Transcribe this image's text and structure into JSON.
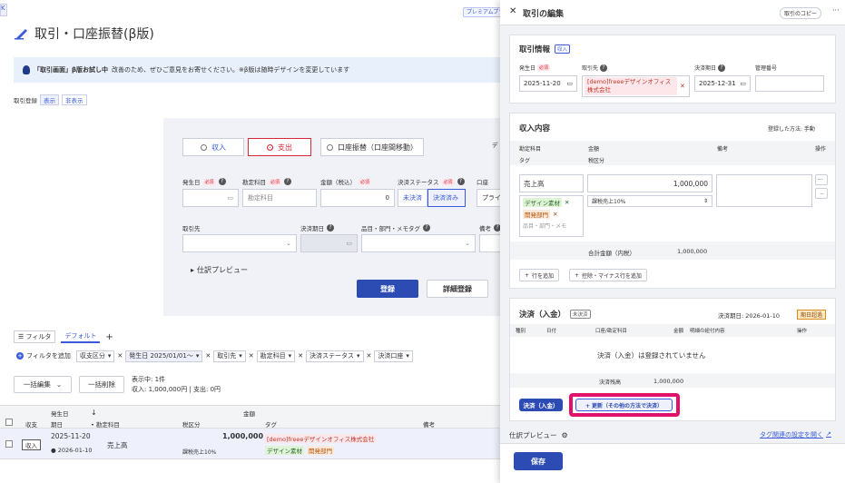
{
  "bg": {
    "edge_btn": "K",
    "premium": "プレミアムプラン",
    "title": "取引・口座振替(β版)",
    "banner": {
      "bold": "「取引画面」β版お試し中",
      "text": "改善のため、ぜひご意見をお寄せください。※β版は随時デザインを変更しています"
    },
    "reg": {
      "label": "取引登録",
      "show": "表示",
      "hide": "非表示"
    },
    "radios": {
      "income": "収入",
      "expense": "支出",
      "transfer": "口座振替（口座間移動）"
    },
    "form": {
      "cut_label": "デ",
      "date": "発生日",
      "account": "勘定科目",
      "account_ph": "勘定科目",
      "amount": "金額（税込）",
      "amount_val": "0",
      "status": "決済ステータス",
      "unpaid": "未決済",
      "paid": "決済済み",
      "acct2": "口座",
      "acct2_val": "プライ",
      "partner": "取引先",
      "due": "決済期日",
      "item": "品目・部門・メモタグ",
      "memo": "備考",
      "preview": "仕訳プレビュー",
      "register": "登録",
      "detail": "詳細登録",
      "required": "必須"
    },
    "filter": {
      "btn": "フィルタ",
      "default": "デフォルト",
      "add": "+",
      "add_filter": "フィルタを追加",
      "chips": [
        "収支区分",
        "発生日 2025/01/01〜",
        "取引先",
        "勘定科目",
        "決済ステータス",
        "決済口座"
      ]
    },
    "bulk": {
      "edit": "一括編集",
      "delete": "一括削除",
      "count": "表示中: 1件",
      "sum": "収入: 1,000,000円 | 支出: 0円"
    },
    "table": {
      "headers": {
        "income_exp": "収支",
        "date_top": "発生日",
        "date": "期日",
        "account": "勘定科目",
        "tax": "税区分",
        "amount": "金額",
        "tag": "タグ",
        "memo": "備考"
      },
      "row": {
        "type": "収入",
        "date": "2025-11-20",
        "due": "2026-01-10",
        "account": "売上高",
        "amount": "1,000,000",
        "tax": "課税売上10%",
        "partner": "[demo]freeeデザインオフィス株式会社",
        "tag1": "デザイン素材",
        "tag2": "開発部門"
      }
    }
  },
  "drawer": {
    "title": "取引の編集",
    "copy": "取引のコピー",
    "info": {
      "title": "取引情報",
      "badge": "収入",
      "date_label": "発生日",
      "required": "必須",
      "partner_label": "取引先",
      "due_label": "決済期日",
      "mgmt_label": "管理番号",
      "date": "2025-11-20",
      "partner": "[demo]freeeデザインオフィス株式会社",
      "due": "2025-12-31"
    },
    "content": {
      "title": "収入内容",
      "method_label": "登録した方法: 手動",
      "h_account": "勘定科目",
      "h_amount": "金額",
      "h_memo": "備考",
      "h_ops": "操作",
      "h_tag": "タグ",
      "h_tax": "税区分",
      "account": "売上高",
      "amount": "1,000,000",
      "tax": "課税売上10%",
      "tag1": "デザイン素材",
      "tag2": "開発部門",
      "tag_ph": "品目・部門・メモ",
      "total_label": "合計金額（内税）",
      "total": "1,000,000",
      "add_row": "行を追加",
      "add_deduct": "控除・マイナス行を追加"
    },
    "settle": {
      "title": "決済（入金）",
      "badge": "未決済",
      "due": "決済期日: 2026-01-10",
      "overdue": "期日超過",
      "h_type": "種別",
      "h_date": "日付",
      "h_acct": "口座/勘定科目",
      "h_amount": "金額",
      "h_detail": "明細の紐付内容",
      "h_ops": "操作",
      "empty": "決済（入金）は登録されていません",
      "remain_label": "決済残高",
      "remain": "1,000,000",
      "btn_settle": "決済（入金）",
      "btn_update": "+ 更新（その他の方法で決済）"
    },
    "preview": "仕訳プレビュー",
    "tag_link": "タグ関連の設定を開く",
    "save": "保存"
  }
}
